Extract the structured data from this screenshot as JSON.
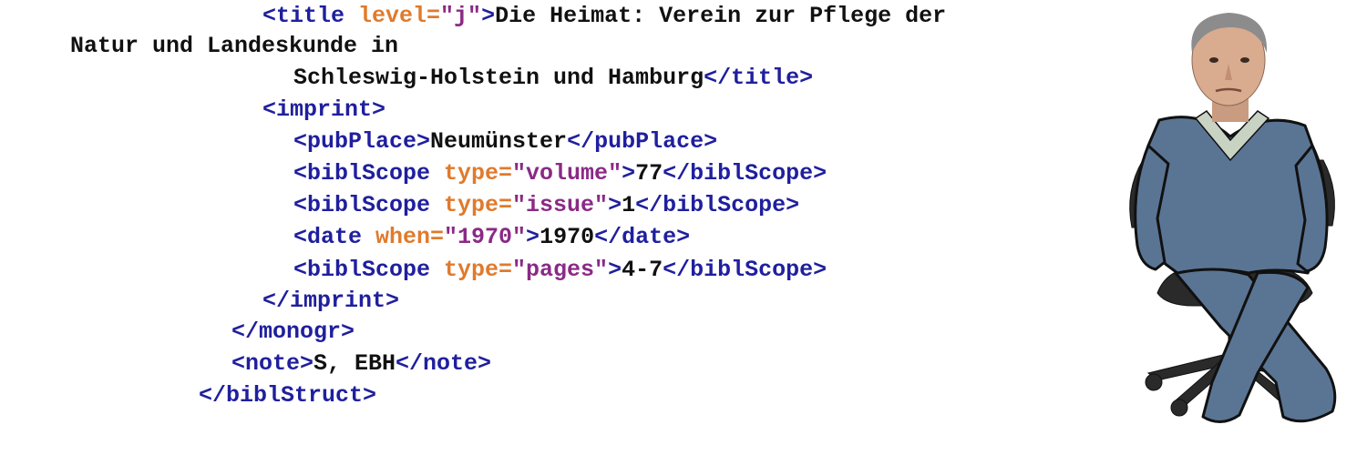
{
  "code_lines": [
    {
      "id": "line1",
      "parts": [
        {
          "kind": "tag",
          "text": "<title "
        },
        {
          "kind": "attr",
          "text": "level="
        },
        {
          "kind": "val",
          "text": "\"j\""
        },
        {
          "kind": "tag",
          "text": ">"
        },
        {
          "kind": "txt",
          "text": "Die Heimat: Verein zur Pflege der"
        }
      ]
    },
    {
      "id": "line2",
      "parts": [
        {
          "kind": "txt",
          "text": "Natur und Landeskunde in"
        }
      ]
    },
    {
      "id": "line3",
      "parts": [
        {
          "kind": "txt",
          "text": "Schleswig-Holstein und Hamburg"
        },
        {
          "kind": "tag",
          "text": "</title>"
        }
      ]
    },
    {
      "id": "line4",
      "parts": [
        {
          "kind": "tag",
          "text": "<imprint>"
        }
      ]
    },
    {
      "id": "line5",
      "parts": [
        {
          "kind": "tag",
          "text": "<pubPlace>"
        },
        {
          "kind": "txt",
          "text": "Neumünster"
        },
        {
          "kind": "tag",
          "text": "</pubPlace>"
        }
      ]
    },
    {
      "id": "line6",
      "parts": [
        {
          "kind": "tag",
          "text": "<biblScope "
        },
        {
          "kind": "attr",
          "text": "type="
        },
        {
          "kind": "val",
          "text": "\"volume\""
        },
        {
          "kind": "tag",
          "text": ">"
        },
        {
          "kind": "txt",
          "text": "77"
        },
        {
          "kind": "tag",
          "text": "</biblScope>"
        }
      ]
    },
    {
      "id": "line7",
      "parts": [
        {
          "kind": "tag",
          "text": "<biblScope "
        },
        {
          "kind": "attr",
          "text": "type="
        },
        {
          "kind": "val",
          "text": "\"issue\""
        },
        {
          "kind": "tag",
          "text": ">"
        },
        {
          "kind": "txt",
          "text": "1"
        },
        {
          "kind": "tag",
          "text": "</biblScope>"
        }
      ]
    },
    {
      "id": "line8",
      "parts": [
        {
          "kind": "tag",
          "text": "<date "
        },
        {
          "kind": "attr",
          "text": "when="
        },
        {
          "kind": "val",
          "text": "\"1970\""
        },
        {
          "kind": "tag",
          "text": ">"
        },
        {
          "kind": "txt",
          "text": "1970"
        },
        {
          "kind": "tag",
          "text": "</date>"
        }
      ]
    },
    {
      "id": "line9",
      "parts": [
        {
          "kind": "tag",
          "text": "<biblScope "
        },
        {
          "kind": "attr",
          "text": "type="
        },
        {
          "kind": "val",
          "text": "\"pages\""
        },
        {
          "kind": "tag",
          "text": ">"
        },
        {
          "kind": "txt",
          "text": "4-7"
        },
        {
          "kind": "tag",
          "text": "</biblScope>"
        }
      ]
    },
    {
      "id": "line10",
      "parts": [
        {
          "kind": "tag",
          "text": "</imprint>"
        }
      ]
    },
    {
      "id": "line11",
      "parts": [
        {
          "kind": "tag",
          "text": "</monogr>"
        }
      ]
    },
    {
      "id": "line12",
      "parts": [
        {
          "kind": "tag",
          "text": "<note>"
        },
        {
          "kind": "txt",
          "text": "S, EBH"
        },
        {
          "kind": "tag",
          "text": "</note>"
        }
      ]
    },
    {
      "id": "line13",
      "parts": [
        {
          "kind": "tag",
          "text": "</biblStruct>"
        }
      ]
    }
  ],
  "colors": {
    "tag": "#1f1f9e",
    "attribute": "#e07a2c",
    "value": "#8a2a86",
    "text": "#111111",
    "figure_outfit": "#5a7594"
  },
  "figure": {
    "icon": "person-on-office-chair-icon"
  }
}
